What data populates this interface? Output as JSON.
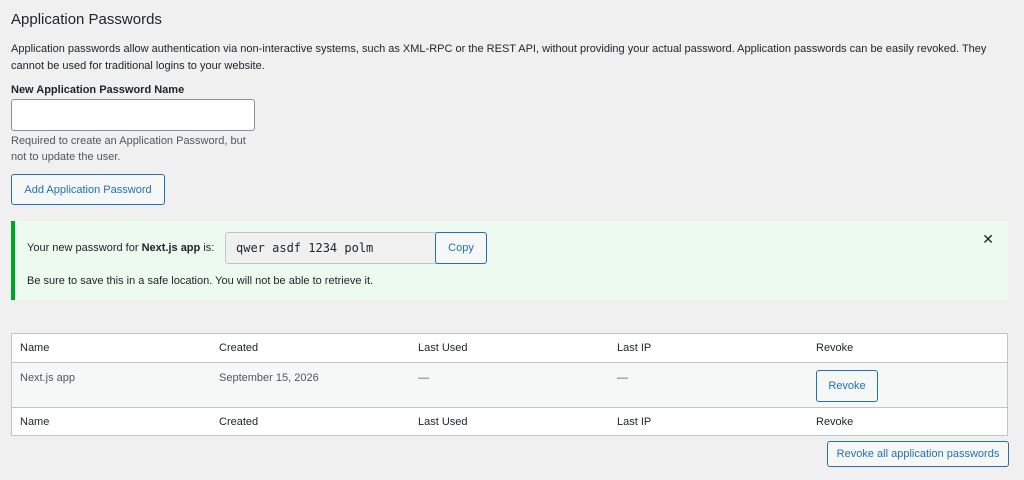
{
  "section": {
    "title": "Application Passwords",
    "description": "Application passwords allow authentication via non-interactive systems, such as XML-RPC or the REST API, without providing your actual password. Application passwords can be easily revoked. They cannot be used for traditional logins to your website."
  },
  "new_password": {
    "label": "New Application Password Name",
    "value": "",
    "placeholder": "",
    "help": "Required to create an Application Password, but not to update the user.",
    "add_button": "Add Application Password"
  },
  "notice": {
    "prefix": "Your new password for",
    "app_name": "Next.js app",
    "suffix": "is:",
    "password": "qwer asdf 1234 polm",
    "copy_button": "Copy",
    "warning": "Be sure to save this in a safe location. You will not be able to retrieve it.",
    "dismiss": "✕",
    "accent_color": "#00a32a",
    "background_color": "#edfaef"
  },
  "table": {
    "columns": [
      "Name",
      "Created",
      "Last Used",
      "Last IP",
      "Revoke"
    ],
    "rows": [
      {
        "name": "Next.js app",
        "created": "September 15, 2026",
        "last_used": "—",
        "last_ip": "—",
        "revoke_button": "Revoke"
      }
    ]
  },
  "revoke_all_button": "Revoke all application passwords",
  "colors": {
    "primary": "#2271b1",
    "page_background": "#f0f0f1"
  }
}
